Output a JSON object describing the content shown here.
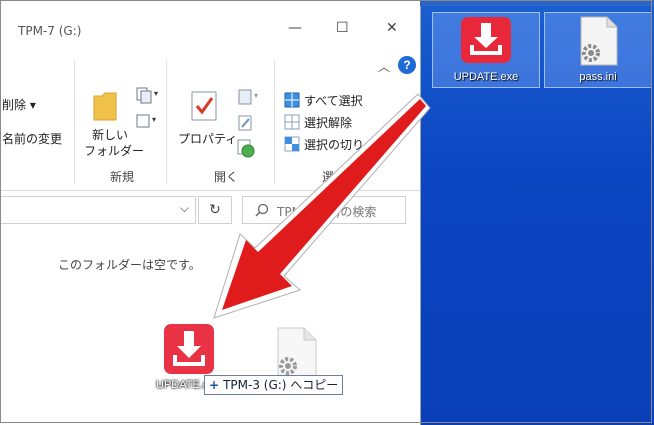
{
  "window": {
    "title": "TPM-7 (G:)",
    "controls": {
      "minimize": "—",
      "maximize": "☐",
      "close": "✕"
    }
  },
  "ribbon": {
    "delete_label": "削除 ▾",
    "rename_label": "名前の変更",
    "new_folder_label_1": "新しい",
    "new_folder_label_2": "フォルダー",
    "properties_label": "プロパティ",
    "select_all_label": "すべて選択",
    "select_none_label": "選択解除",
    "invert_selection_label": "選択の切り",
    "group_new": "新規",
    "group_open": "開く",
    "group_select": "選"
  },
  "address": {
    "refresh_icon": "↻",
    "dropdown_icon": "⌵",
    "search_placeholder": "TPM-7 (G:)の検索"
  },
  "content": {
    "empty_message": "このフォルダーは空です。"
  },
  "drag": {
    "ghost_label": "UPDATE.exe",
    "copy_plus": "+",
    "copy_text": "TPM-3 (G:) へコピー"
  },
  "desktop": {
    "icons": [
      {
        "label": "UPDATE.exe",
        "icon": "download-app-icon"
      },
      {
        "label": "pass.ini",
        "icon": "settings-file-icon"
      }
    ]
  },
  "colors": {
    "arrow": "#e01b1b",
    "desktop_blue": "#0c46c2",
    "app_red": "#e8283a",
    "help_blue": "#1e6bd6"
  }
}
